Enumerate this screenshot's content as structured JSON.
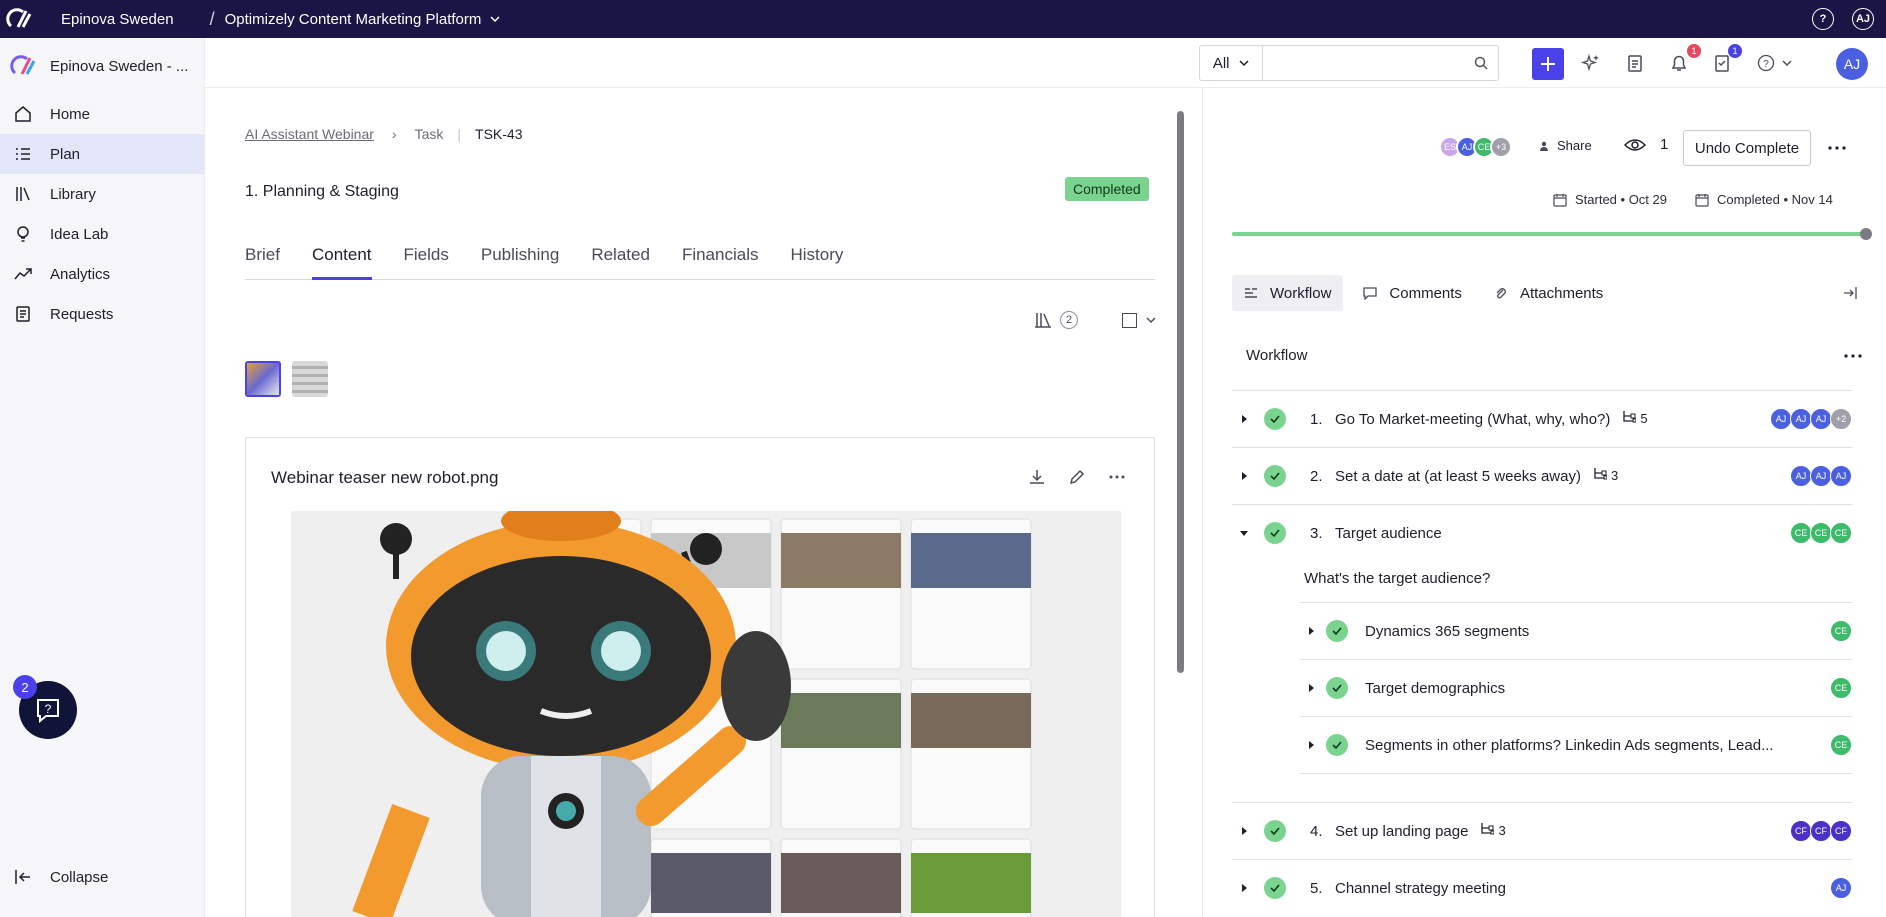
{
  "topbar": {
    "org": "Epinova Sweden",
    "app": "Optimizely Content Marketing Platform",
    "user_initials": "AJ"
  },
  "sidebar": {
    "workspace": "Epinova Sweden - ...",
    "items": [
      {
        "label": "Home",
        "icon": "home-icon"
      },
      {
        "label": "Plan",
        "icon": "list-icon"
      },
      {
        "label": "Library",
        "icon": "library-icon"
      },
      {
        "label": "Idea Lab",
        "icon": "bulb-icon"
      },
      {
        "label": "Analytics",
        "icon": "trend-icon"
      },
      {
        "label": "Requests",
        "icon": "request-icon"
      }
    ],
    "help_count": "2",
    "collapse": "Collapse"
  },
  "toolbar": {
    "scope": "All",
    "search_placeholder": "",
    "notif_count": "1",
    "task_count": "1",
    "avatar": "AJ"
  },
  "breadcrumb": {
    "project": "AI Assistant Webinar",
    "type": "Task",
    "id": "TSK-43"
  },
  "task": {
    "title": "1. Planning & Staging",
    "status": "Completed"
  },
  "tabs": [
    "Brief",
    "Content",
    "Fields",
    "Publishing",
    "Related",
    "Financials",
    "History"
  ],
  "content": {
    "asset_count": "2",
    "asset_name": "Webinar teaser new robot.png"
  },
  "right": {
    "collaborators": [
      {
        "initials": "ES",
        "color": "#c9a6e8"
      },
      {
        "initials": "AJ",
        "color": "#4b60e0"
      },
      {
        "initials": "CE",
        "color": "#3dba6a"
      },
      {
        "initials": "+3",
        "color": "#a0a0aa"
      }
    ],
    "share": "Share",
    "watchers": "1",
    "undo": "Undo Complete",
    "started": "Started • Oct 29",
    "completed": "Completed • Nov 14",
    "progress": 1.0,
    "tabs": [
      "Workflow",
      "Comments",
      "Attachments"
    ],
    "workflow_title": "Workflow",
    "steps": [
      {
        "num": "1.",
        "name": "Go To Market-meeting (What, why, who?)",
        "subs": "5",
        "avatars": [
          {
            "t": "AJ",
            "c": "#4b60e0"
          },
          {
            "t": "AJ",
            "c": "#4b60e0"
          },
          {
            "t": "AJ",
            "c": "#4b60e0"
          },
          {
            "t": "+2",
            "c": "#a0a0aa"
          }
        ]
      },
      {
        "num": "2.",
        "name": "Set a date at (at least 5 weeks away)",
        "subs": "3",
        "avatars": [
          {
            "t": "AJ",
            "c": "#4b60e0"
          },
          {
            "t": "AJ",
            "c": "#4b60e0"
          },
          {
            "t": "AJ",
            "c": "#4b60e0"
          }
        ]
      },
      {
        "num": "3.",
        "name": "Target audience",
        "subs": "",
        "avatars": [
          {
            "t": "CE",
            "c": "#3dba6a"
          },
          {
            "t": "CE",
            "c": "#3dba6a"
          },
          {
            "t": "CE",
            "c": "#3dba6a"
          }
        ]
      }
    ],
    "question": "What's the target audience?",
    "substeps": [
      {
        "name": "Dynamics 365 segments",
        "avatar": "CE"
      },
      {
        "name": "Target demographics",
        "avatar": "CE"
      },
      {
        "name": "Segments in other platforms? Linkedin Ads segments, Lead...",
        "avatar": "CE"
      }
    ],
    "later_steps": [
      {
        "num": "4.",
        "name": "Set up landing page",
        "subs": "3",
        "avatars": [
          {
            "t": "CF",
            "c": "#4b31c8"
          },
          {
            "t": "CF",
            "c": "#4b31c8"
          },
          {
            "t": "CF",
            "c": "#4b31c8"
          }
        ]
      },
      {
        "num": "5.",
        "name": "Channel strategy meeting",
        "subs": "",
        "avatars": [
          {
            "t": "AJ",
            "c": "#4b60e0"
          }
        ]
      }
    ]
  }
}
